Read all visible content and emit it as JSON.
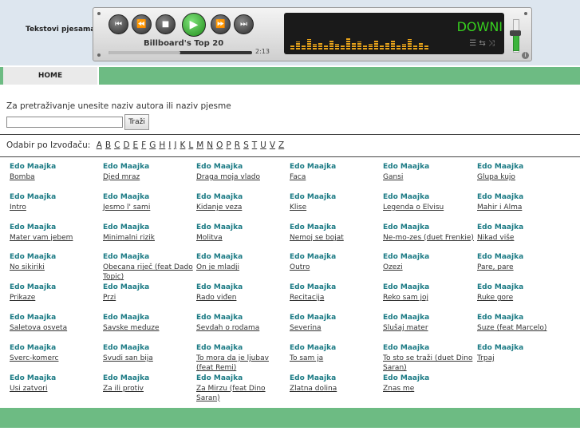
{
  "site": {
    "title": "Tekstovi pjesama"
  },
  "player": {
    "track_title": "Billboard's Top 20",
    "time": "2:13",
    "progress": 0.5,
    "display_text": "DOWNI",
    "volume": 0.55,
    "buttons": [
      {
        "name": "prev-track-button",
        "glyph": "⏮"
      },
      {
        "name": "rewind-button",
        "glyph": "⏪"
      },
      {
        "name": "stop-button",
        "glyph": "■"
      },
      {
        "name": "play-button",
        "glyph": "▶"
      },
      {
        "name": "fast-forward-button",
        "glyph": "⏩"
      },
      {
        "name": "next-track-button",
        "glyph": "⏭"
      }
    ],
    "eq_levels": [
      0.25,
      0.4,
      0.2,
      0.55,
      0.3,
      0.35,
      0.2,
      0.45,
      0.3,
      0.25,
      0.6,
      0.35,
      0.4,
      0.2,
      0.3,
      0.5,
      0.25,
      0.35,
      0.45,
      0.2,
      0.3,
      0.55,
      0.25,
      0.35,
      0.2
    ]
  },
  "nav": {
    "home_label": "HOME"
  },
  "search": {
    "label": "Za pretraživanje unesite naziv autora ili naziv pjesme",
    "input_value": "",
    "button_label": "Traži"
  },
  "alphabet": {
    "label": "Odabir po Izvođaču:",
    "letters": [
      "A",
      "B",
      "C",
      "D",
      "E",
      "F",
      "G",
      "H",
      "I",
      "J",
      "K",
      "L",
      "M",
      "N",
      "O",
      "P",
      "R",
      "S",
      "T",
      "U",
      "V",
      "Z"
    ]
  },
  "songs": [
    {
      "artist": "Edo Maajka",
      "title": "Bomba"
    },
    {
      "artist": "Edo Maajka",
      "title": "Djed mraz"
    },
    {
      "artist": "Edo Maajka",
      "title": "Draga moja vlado"
    },
    {
      "artist": "Edo Maajka",
      "title": "Faca"
    },
    {
      "artist": "Edo Maajka",
      "title": "Gansi"
    },
    {
      "artist": "Edo Maajka",
      "title": "Glupa kujo"
    },
    {
      "artist": "Edo Maajka",
      "title": "Intro"
    },
    {
      "artist": "Edo Maajka",
      "title": "Jesmo l' sami"
    },
    {
      "artist": "Edo Maajka",
      "title": "Kidanje veza"
    },
    {
      "artist": "Edo Maajka",
      "title": "Klise"
    },
    {
      "artist": "Edo Maajka",
      "title": "Legenda o Elvisu"
    },
    {
      "artist": "Edo Maajka",
      "title": "Mahir i Alma"
    },
    {
      "artist": "Edo Maajka",
      "title": "Mater vam jebem"
    },
    {
      "artist": "Edo Maajka",
      "title": "Minimalni rizik"
    },
    {
      "artist": "Edo Maajka",
      "title": "Molitva"
    },
    {
      "artist": "Edo Maajka",
      "title": "Nemoj se bojat"
    },
    {
      "artist": "Edo Maajka",
      "title": "Ne-mo-zes (duet Frenkie)"
    },
    {
      "artist": "Edo Maajka",
      "title": "Nikad više"
    },
    {
      "artist": "Edo Maajka",
      "title": "No sikiriki"
    },
    {
      "artist": "Edo Maajka",
      "title": "Obecana riječ (feat Dado Topic)"
    },
    {
      "artist": "Edo Maajka",
      "title": "On je mladji"
    },
    {
      "artist": "Edo Maajka",
      "title": "Outro"
    },
    {
      "artist": "Edo Maajka",
      "title": "Ozezi"
    },
    {
      "artist": "Edo Maajka",
      "title": "Pare, pare"
    },
    {
      "artist": "Edo Maajka",
      "title": "Prikaze"
    },
    {
      "artist": "Edo Maajka",
      "title": "Przi"
    },
    {
      "artist": "Edo Maajka",
      "title": "Rado viđen"
    },
    {
      "artist": "Edo Maajka",
      "title": "Recitacija"
    },
    {
      "artist": "Edo Maajka",
      "title": "Reko sam joj"
    },
    {
      "artist": "Edo Maajka",
      "title": "Ruke gore"
    },
    {
      "artist": "Edo Maajka",
      "title": "Saletova osveta"
    },
    {
      "artist": "Edo Maajka",
      "title": "Savske meduze"
    },
    {
      "artist": "Edo Maajka",
      "title": "Sevdah o rodama"
    },
    {
      "artist": "Edo Maajka",
      "title": "Severina"
    },
    {
      "artist": "Edo Maajka",
      "title": "Slušaj mater"
    },
    {
      "artist": "Edo Maajka",
      "title": "Suze (feat Marcelo)"
    },
    {
      "artist": "Edo Maajka",
      "title": "Sverc-komerc"
    },
    {
      "artist": "Edo Maajka",
      "title": "Svudi san bija"
    },
    {
      "artist": "Edo Maajka",
      "title": "To mora da je ljubav (feat Remi)"
    },
    {
      "artist": "Edo Maajka",
      "title": "To sam ja"
    },
    {
      "artist": "Edo Maajka",
      "title": "To sto se traži (duet Dino Saran)"
    },
    {
      "artist": "Edo Maajka",
      "title": "Trpaj"
    },
    {
      "artist": "Edo Maajka",
      "title": "Usi zatvori"
    },
    {
      "artist": "Edo Maajka",
      "title": "Za ili protiv"
    },
    {
      "artist": "Edo Maajka",
      "title": "Za Mirzu (feat Dino Saran)"
    },
    {
      "artist": "Edo Maajka",
      "title": "Zlatna dolina"
    },
    {
      "artist": "Edo Maajka",
      "title": "Znas me"
    }
  ]
}
